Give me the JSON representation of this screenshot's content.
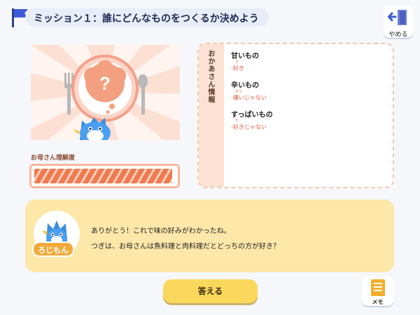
{
  "header": {
    "mission_title": "ミッション１：誰にどんなものをつくるか決めよう",
    "quit_label": "やめる"
  },
  "gauge": {
    "label": "お母さん理解度",
    "level_fraction": 0.98
  },
  "info_panel": {
    "title": "おかあさん情報",
    "items": [
      {
        "name": "甘いもの",
        "ruby": "す",
        "pref": "-好き"
      },
      {
        "name": "辛いもの",
        "ruby": "きら",
        "pref": "-嫌いじゃない"
      },
      {
        "name": "すっぱいもの",
        "ruby": "す",
        "pref": "-好きじゃない"
      }
    ]
  },
  "dialog": {
    "speaker": "ろじもん",
    "lines": [
      "ありがとう！これで味の好みがわかったね。",
      "つぎは、お母さんは魚料理と肉料理だとどっちの方が好き？"
    ]
  },
  "footer": {
    "answer_label": "答える",
    "memo_label": "メモ"
  },
  "colors": {
    "accent_orange": "#f07a4e",
    "dialog_bg": "#fde7a9",
    "button_yellow": "#fbd85c",
    "navy": "#1f2a55"
  }
}
